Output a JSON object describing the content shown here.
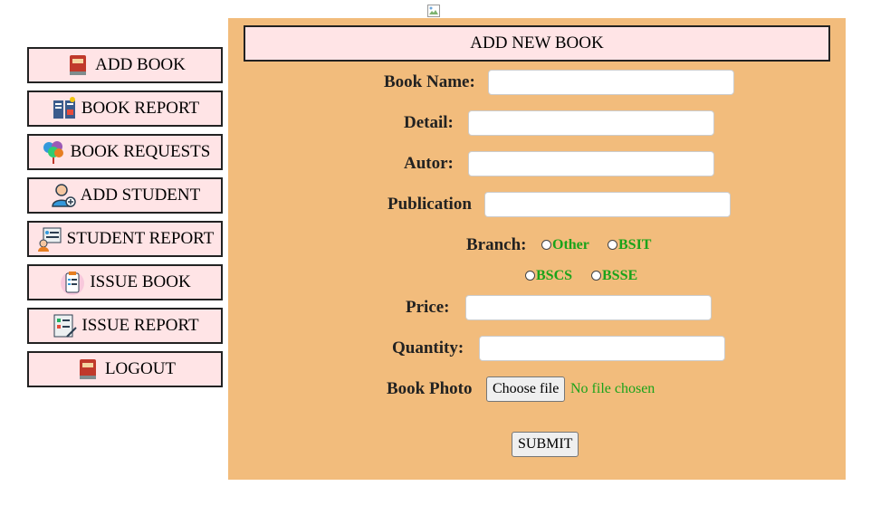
{
  "sidebar": {
    "items": [
      {
        "label": "ADD BOOK",
        "icon": "book-icon"
      },
      {
        "label": "BOOK REPORT",
        "icon": "book-report-icon"
      },
      {
        "label": "BOOK REQUESTS",
        "icon": "balloons-icon"
      },
      {
        "label": "ADD STUDENT",
        "icon": "add-user-icon"
      },
      {
        "label": "STUDENT REPORT",
        "icon": "student-report-icon"
      },
      {
        "label": "ISSUE BOOK",
        "icon": "clipboard-icon"
      },
      {
        "label": "ISSUE REPORT",
        "icon": "report-icon"
      },
      {
        "label": "LOGOUT",
        "icon": "book-icon"
      }
    ]
  },
  "form": {
    "title": "ADD NEW BOOK",
    "book_name_label": "Book Name:",
    "detail_label": "Detail:",
    "author_label": "Autor:",
    "publication_label": "Publication",
    "branch_label": "Branch:",
    "branch_options": [
      "Other",
      "BSIT",
      "BSCS",
      "BSSE"
    ],
    "price_label": "Price:",
    "quantity_label": "Quantity:",
    "photo_label": "Book Photo",
    "choose_file_label": "Choose file",
    "file_status": "No file chosen",
    "submit_label": "SUBMIT"
  },
  "colors": {
    "panel": "#f2bc7c",
    "button_bg": "#ffe4e6",
    "radio_text": "#1aa31a"
  }
}
